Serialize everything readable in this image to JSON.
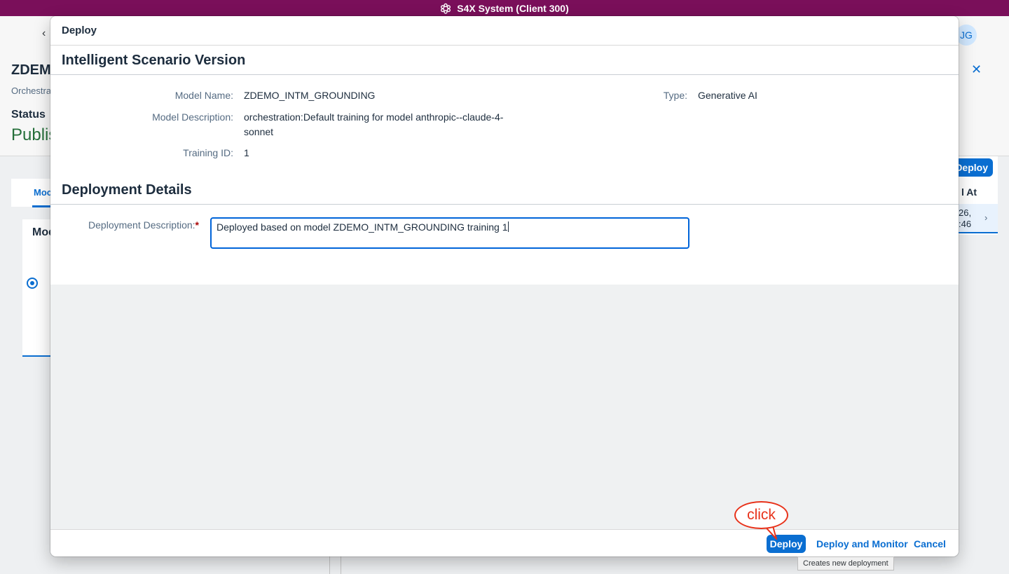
{
  "system_bar": {
    "title": "S4X System (Client 300)",
    "logo_icon": "sap-flower-icon"
  },
  "background": {
    "title": "ZDEMO",
    "subtitle": "Orchestra",
    "status_label": "Status",
    "status_value": "Publis",
    "avatar": "JG",
    "tab": "Moc",
    "panel_title": "Mod",
    "deploy_button": "Deploy",
    "column_header": "l At",
    "row_text_1": "26,",
    "row_text_2": ":46"
  },
  "dialog": {
    "title": "Deploy",
    "section1": {
      "title": "Intelligent Scenario Version",
      "model_name_label": "Model Name:",
      "model_name_value": "ZDEMO_INTM_GROUNDING",
      "type_label": "Type:",
      "type_value": "Generative AI",
      "model_desc_label": "Model Description:",
      "model_desc_value_line1": "orchestration:Default training for model anthropic--claude-4-",
      "model_desc_value_line2": "sonnet",
      "training_id_label": "Training ID:",
      "training_id_value": "1"
    },
    "section2": {
      "title": "Deployment Details",
      "desc_label": "Deployment Description:",
      "desc_required": "*",
      "desc_value": "Deployed based on model ZDEMO_INTM_GROUNDING training 1"
    },
    "footer": {
      "deploy": "Deploy",
      "deploy_and_monitor": "Deploy and Monitor",
      "cancel": "Cancel"
    }
  },
  "annotation": {
    "callout_text": "click",
    "color": "#e8321a"
  },
  "tooltip": {
    "text": "Creates new deployment"
  },
  "colors": {
    "system_bar": "#7a0f5a",
    "accent": "#0a6ed1",
    "status_green": "#256f3a"
  }
}
